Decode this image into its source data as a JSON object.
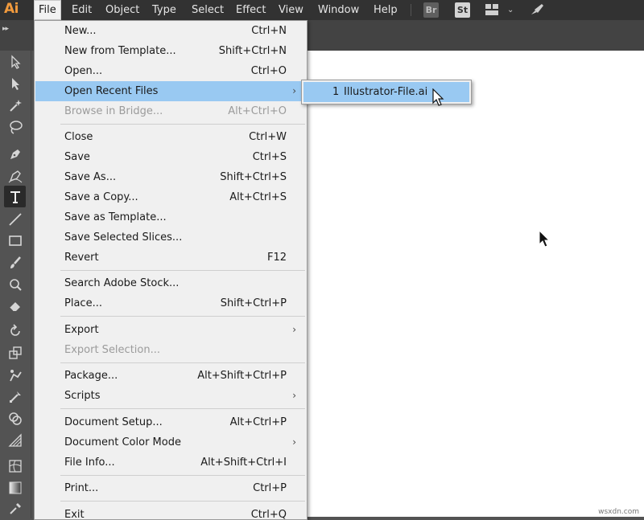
{
  "app": {
    "logo_text": "Ai",
    "brand_color": "#f19a3d",
    "menus": [
      {
        "label": "File",
        "active": true
      },
      {
        "label": "Edit"
      },
      {
        "label": "Object"
      },
      {
        "label": "Type"
      },
      {
        "label": "Select"
      },
      {
        "label": "Effect"
      },
      {
        "label": "View"
      },
      {
        "label": "Window"
      },
      {
        "label": "Help"
      }
    ],
    "bridge_badge": "Br",
    "stock_badge": "St",
    "workspace_icon": "workspace-grid-icon",
    "chevron_icon": "chevron-down-icon",
    "rocket_icon": "rocket-icon"
  },
  "file_menu": {
    "items": [
      {
        "label": "New...",
        "shortcut": "Ctrl+N"
      },
      {
        "label": "New from Template...",
        "shortcut": "Shift+Ctrl+N"
      },
      {
        "label": "Open...",
        "shortcut": "Ctrl+O"
      },
      {
        "label": "Open Recent Files",
        "submenu": true,
        "highlighted": true
      },
      {
        "label": "Browse in Bridge...",
        "shortcut": "Alt+Ctrl+O",
        "disabled": true
      },
      {
        "label": "Close",
        "shortcut": "Ctrl+W"
      },
      {
        "label": "Save",
        "shortcut": "Ctrl+S"
      },
      {
        "label": "Save As...",
        "shortcut": "Shift+Ctrl+S"
      },
      {
        "label": "Save a Copy...",
        "shortcut": "Alt+Ctrl+S"
      },
      {
        "label": "Save as Template..."
      },
      {
        "label": "Save Selected Slices..."
      },
      {
        "label": "Revert",
        "shortcut": "F12"
      },
      {
        "label": "Search Adobe Stock..."
      },
      {
        "label": "Place...",
        "shortcut": "Shift+Ctrl+P"
      },
      {
        "label": "Export",
        "submenu": true
      },
      {
        "label": "Export Selection...",
        "disabled": true
      },
      {
        "label": "Package...",
        "shortcut": "Alt+Shift+Ctrl+P"
      },
      {
        "label": "Scripts",
        "submenu": true
      },
      {
        "label": "Document Setup...",
        "shortcut": "Alt+Ctrl+P"
      },
      {
        "label": "Document Color Mode",
        "submenu": true
      },
      {
        "label": "File Info...",
        "shortcut": "Alt+Shift+Ctrl+I"
      },
      {
        "label": "Print...",
        "shortcut": "Ctrl+P"
      },
      {
        "label": "Exit",
        "shortcut": "Ctrl+Q"
      }
    ],
    "submenu_arrow": "›"
  },
  "recent_files": [
    {
      "number": "1",
      "name": "Illustrator-File.ai"
    }
  ],
  "tools": [
    "selection-tool-icon",
    "direct-selection-tool-icon",
    "magic-wand-tool-icon",
    "lasso-tool-icon",
    "pen-tool-icon",
    "curvature-tool-icon",
    "type-tool-icon",
    "line-segment-tool-icon",
    "rectangle-tool-icon",
    "paintbrush-tool-icon",
    "shaper-tool-icon",
    "eraser-tool-icon",
    "rotate-tool-icon",
    "scale-tool-icon",
    "puppet-warp-tool-icon",
    "free-transform-tool-icon",
    "shape-builder-tool-icon",
    "perspective-grid-tool-icon",
    "mesh-tool-icon",
    "gradient-tool-icon",
    "eyedropper-tool-icon"
  ],
  "watermark": "wsxdn.com"
}
